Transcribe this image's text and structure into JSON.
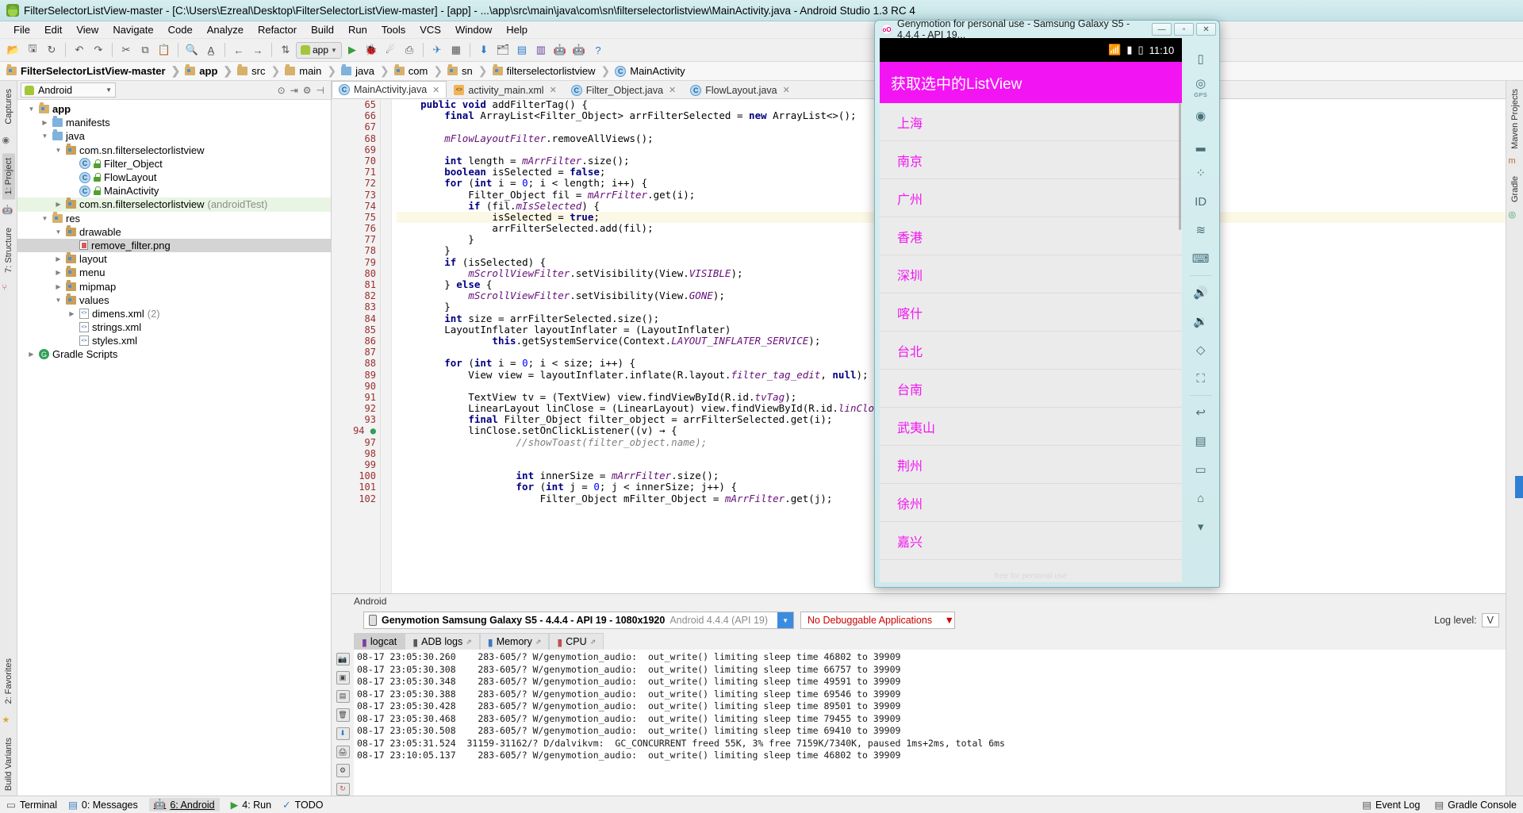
{
  "window": {
    "title": "FilterSelectorListView-master - [C:\\Users\\Ezreal\\Desktop\\FilterSelectorListView-master] - [app] - ...\\app\\src\\main\\java\\com\\sn\\filterselectorlistview\\MainActivity.java - Android Studio 1.3 RC 4"
  },
  "menu": [
    "File",
    "Edit",
    "View",
    "Navigate",
    "Code",
    "Analyze",
    "Refactor",
    "Build",
    "Run",
    "Tools",
    "VCS",
    "Window",
    "Help"
  ],
  "toolbar": {
    "run_config": "app"
  },
  "breadcrumb": [
    {
      "label": "FilterSelectorListView-master",
      "icon": "module-icon",
      "bold": true
    },
    {
      "label": "app",
      "icon": "module-icon",
      "bold": true
    },
    {
      "label": "src",
      "icon": "folder-icon",
      "bold": false
    },
    {
      "label": "main",
      "icon": "folder-icon",
      "bold": false
    },
    {
      "label": "java",
      "icon": "folder-blue-icon",
      "bold": false
    },
    {
      "label": "com",
      "icon": "package-icon",
      "bold": false
    },
    {
      "label": "sn",
      "icon": "package-icon",
      "bold": false
    },
    {
      "label": "filterselectorlistview",
      "icon": "package-icon",
      "bold": false
    },
    {
      "label": "MainActivity",
      "icon": "class-icon",
      "bold": false
    }
  ],
  "left_rail": [
    "Captures",
    "1: Project",
    "7: Structure"
  ],
  "right_rail": [
    "Maven Projects",
    "Gradle"
  ],
  "project": {
    "view_selector": "Android",
    "tree": [
      {
        "label": "app",
        "indent": 0,
        "twisty": "down",
        "icon": "module-icon",
        "bold": true,
        "state": "normal"
      },
      {
        "label": "manifests",
        "indent": 1,
        "twisty": "right",
        "icon": "folder-blue-icon",
        "bold": false,
        "state": "normal"
      },
      {
        "label": "java",
        "indent": 1,
        "twisty": "down",
        "icon": "folder-blue-icon",
        "bold": false,
        "state": "normal"
      },
      {
        "label": "com.sn.filterselectorlistview",
        "indent": 2,
        "twisty": "down",
        "icon": "package-icon",
        "bold": false,
        "state": "normal"
      },
      {
        "label": "Filter_Object",
        "indent": 3,
        "twisty": "none",
        "icon": "class-icon",
        "bold": false,
        "state": "normal"
      },
      {
        "label": "FlowLayout",
        "indent": 3,
        "twisty": "none",
        "icon": "class-icon",
        "bold": false,
        "state": "normal"
      },
      {
        "label": "MainActivity",
        "indent": 3,
        "twisty": "none",
        "icon": "class-icon",
        "bold": false,
        "state": "normal"
      },
      {
        "label": "com.sn.filterselectorlistview",
        "suffix": "(androidTest)",
        "indent": 2,
        "twisty": "right",
        "icon": "package-icon",
        "bold": false,
        "state": "green"
      },
      {
        "label": "res",
        "indent": 1,
        "twisty": "down",
        "icon": "res-icon",
        "bold": false,
        "state": "normal"
      },
      {
        "label": "drawable",
        "indent": 2,
        "twisty": "down",
        "icon": "package-icon",
        "bold": false,
        "state": "normal"
      },
      {
        "label": "remove_filter.png",
        "indent": 3,
        "twisty": "none",
        "icon": "image-icon",
        "bold": false,
        "state": "selected"
      },
      {
        "label": "layout",
        "indent": 2,
        "twisty": "right",
        "icon": "package-icon",
        "bold": false,
        "state": "normal"
      },
      {
        "label": "menu",
        "indent": 2,
        "twisty": "right",
        "icon": "package-icon",
        "bold": false,
        "state": "normal"
      },
      {
        "label": "mipmap",
        "indent": 2,
        "twisty": "right",
        "icon": "package-icon",
        "bold": false,
        "state": "normal"
      },
      {
        "label": "values",
        "indent": 2,
        "twisty": "down",
        "icon": "package-icon",
        "bold": false,
        "state": "normal"
      },
      {
        "label": "dimens.xml",
        "suffix": "(2)",
        "indent": 3,
        "twisty": "right",
        "icon": "xml-icon",
        "bold": false,
        "state": "normal"
      },
      {
        "label": "strings.xml",
        "indent": 3,
        "twisty": "none",
        "icon": "xml-icon",
        "bold": false,
        "state": "normal"
      },
      {
        "label": "styles.xml",
        "indent": 3,
        "twisty": "none",
        "icon": "xml-icon",
        "bold": false,
        "state": "normal"
      },
      {
        "label": "Gradle Scripts",
        "indent": 0,
        "twisty": "right",
        "icon": "gradle-icon",
        "bold": false,
        "state": "normal"
      }
    ]
  },
  "editor": {
    "tabs": [
      {
        "label": "MainActivity.java",
        "icon": "class-icon",
        "active": true
      },
      {
        "label": "activity_main.xml",
        "icon": "xml-icon",
        "active": false
      },
      {
        "label": "Filter_Object.java",
        "icon": "class-icon",
        "active": false
      },
      {
        "label": "FlowLayout.java",
        "icon": "class-icon",
        "active": false
      }
    ],
    "line_numbers": [
      65,
      66,
      67,
      68,
      69,
      70,
      71,
      72,
      73,
      74,
      75,
      76,
      77,
      78,
      79,
      80,
      81,
      82,
      83,
      84,
      85,
      86,
      87,
      88,
      89,
      90,
      91,
      92,
      93,
      94,
      97,
      98,
      99,
      100,
      101,
      102
    ],
    "highlight_line": 75,
    "lines": [
      {
        "num": 65,
        "html": "    <span class=\"k\">public void</span> addFilterTag() {"
      },
      {
        "num": 66,
        "html": "        <span class=\"k\">final</span> ArrayList&lt;Filter_Object&gt; arrFilterSelected = <span class=\"k\">new</span> ArrayList&lt;&gt;();"
      },
      {
        "num": 67,
        "html": ""
      },
      {
        "num": 68,
        "html": "        <span class=\"f\">mFlowLayoutFilter</span>.removeAllViews();"
      },
      {
        "num": 69,
        "html": ""
      },
      {
        "num": 70,
        "html": "        <span class=\"k\">int</span> length = <span class=\"f\">mArrFilter</span>.size();"
      },
      {
        "num": 71,
        "html": "        <span class=\"k\">boolean</span> isSelected = <span class=\"k\">false</span>;"
      },
      {
        "num": 72,
        "html": "        <span class=\"k\">for</span> (<span class=\"k\">int</span> i = <span class=\"n\">0</span>; i &lt; length; i++) {"
      },
      {
        "num": 73,
        "html": "            Filter_Object fil = <span class=\"f\">mArrFilter</span>.get(i);"
      },
      {
        "num": 74,
        "html": "            <span class=\"k\">if</span> (fil.<span class=\"f\">mIsSelected</span>) {"
      },
      {
        "num": 75,
        "html": "                isSelected = <span class=\"k\">true</span>;"
      },
      {
        "num": 76,
        "html": "                arrFilterSelected.add(fil);"
      },
      {
        "num": 77,
        "html": "            }"
      },
      {
        "num": 78,
        "html": "        }"
      },
      {
        "num": 79,
        "html": "        <span class=\"k\">if</span> (isSelected) {"
      },
      {
        "num": 80,
        "html": "            <span class=\"f\">mScrollViewFilter</span>.setVisibility(View.<span class=\"m\">VISIBLE</span>);"
      },
      {
        "num": 81,
        "html": "        } <span class=\"k\">else</span> {"
      },
      {
        "num": 82,
        "html": "            <span class=\"f\">mScrollViewFilter</span>.setVisibility(View.<span class=\"m\">GONE</span>);"
      },
      {
        "num": 83,
        "html": "        }"
      },
      {
        "num": 84,
        "html": "        <span class=\"k\">int</span> size = arrFilterSelected.size();"
      },
      {
        "num": 85,
        "html": "        LayoutInflater layoutInflater = (LayoutInflater)"
      },
      {
        "num": 86,
        "html": "                <span class=\"k\">this</span>.getSystemService(Context.<span class=\"m\">LAYOUT_INFLATER_SERVICE</span>);"
      },
      {
        "num": 87,
        "html": ""
      },
      {
        "num": 88,
        "html": "        <span class=\"k\">for</span> (<span class=\"k\">int</span> i = <span class=\"n\">0</span>; i &lt; size; i++) {"
      },
      {
        "num": 89,
        "html": "            View view = layoutInflater.inflate(R.layout.<span class=\"f\">filter_tag_edit</span>, <span class=\"k\">null</span>);"
      },
      {
        "num": 90,
        "html": ""
      },
      {
        "num": 91,
        "html": "            TextView tv = (TextView) view.findViewById(R.id.<span class=\"f\">tvTag</span>);"
      },
      {
        "num": 92,
        "html": "            LinearLayout linClose = (LinearLayout) view.findViewById(R.id.<span class=\"f\">linClose</span>);"
      },
      {
        "num": 93,
        "html": "            <span class=\"k\">final</span> Filter_Object filter_object = arrFilterSelected.get(i);"
      },
      {
        "num": 94,
        "html": "            linClose.setOnClickListener((v) → {"
      },
      {
        "num": 97,
        "html": "                    <span class=\"c\">//showToast(filter_object.name);</span>"
      },
      {
        "num": 98,
        "html": ""
      },
      {
        "num": 99,
        "html": ""
      },
      {
        "num": 100,
        "html": "                    <span class=\"k\">int</span> innerSize = <span class=\"f\">mArrFilter</span>.size();"
      },
      {
        "num": 101,
        "html": "                    <span class=\"k\">for</span> (<span class=\"k\">int</span> j = <span class=\"n\">0</span>; j &lt; innerSize; j++) {"
      },
      {
        "num": 102,
        "html": "                        Filter_Object mFilter_Object = <span class=\"f\">mArrFilter</span>.get(j);"
      }
    ]
  },
  "android_panel": {
    "header": "Android",
    "device": "Genymotion Samsung Galaxy S5 - 4.4.4 - API 19 - 1080x1920",
    "device_suffix": "Android 4.4.4 (API 19)",
    "debuggable": "No Debuggable Applications",
    "log_level_label": "Log level:",
    "log_level_value": "V",
    "tabs": [
      {
        "label": "logcat",
        "active": true
      },
      {
        "label": "ADB logs",
        "active": false
      },
      {
        "label": "Memory",
        "active": false
      },
      {
        "label": "CPU",
        "active": false
      }
    ],
    "log_lines": [
      "08-17 23:05:30.260    283-605/? W/genymotion_audio:  out_write() limiting sleep time 46802 to 39909",
      "08-17 23:05:30.308    283-605/? W/genymotion_audio:  out_write() limiting sleep time 66757 to 39909",
      "08-17 23:05:30.348    283-605/? W/genymotion_audio:  out_write() limiting sleep time 49591 to 39909",
      "08-17 23:05:30.388    283-605/? W/genymotion_audio:  out_write() limiting sleep time 69546 to 39909",
      "08-17 23:05:30.428    283-605/? W/genymotion_audio:  out_write() limiting sleep time 89501 to 39909",
      "08-17 23:05:30.468    283-605/? W/genymotion_audio:  out_write() limiting sleep time 79455 to 39909",
      "08-17 23:05:30.508    283-605/? W/genymotion_audio:  out_write() limiting sleep time 69410 to 39909",
      "08-17 23:05:31.524  31159-31162/? D/dalvikvm:  GC_CONCURRENT freed 55K, 3% free 7159K/7340K, paused 1ms+2ms, total 6ms",
      "08-17 23:10:05.137    283-605/? W/genymotion_audio:  out_write() limiting sleep time 46802 to 39909"
    ]
  },
  "statusbar": {
    "left": [
      {
        "label": "Terminal",
        "icon": "terminal-icon"
      },
      {
        "label": "0: Messages",
        "icon": "messages-icon"
      },
      {
        "label": "6: Android",
        "icon": "android-icon",
        "active": true
      },
      {
        "label": "4: Run",
        "icon": "run-icon"
      },
      {
        "label": "TODO",
        "icon": "todo-icon"
      }
    ],
    "right": [
      {
        "label": "Event Log",
        "icon": "event-log-icon"
      },
      {
        "label": "Gradle Console",
        "icon": "gradle-console-icon"
      }
    ]
  },
  "genymotion": {
    "title": "Genymotion for personal use - Samsung Galaxy S5 - 4.4.4 - API 19...",
    "window_buttons": [
      "minimize",
      "maximize",
      "close"
    ],
    "status_time": "11:10",
    "app_title": "获取选中的ListView",
    "list_items": [
      "上海",
      "南京",
      "广州",
      "香港",
      "深圳",
      "喀什",
      "台北",
      "台南",
      "武夷山",
      "荆州",
      "徐州",
      "嘉兴"
    ],
    "watermark": "free for personal use",
    "side_buttons": [
      {
        "label": "GPS",
        "icon": "phone-icon"
      },
      {
        "label": "",
        "icon": "gps-icon"
      },
      {
        "label": "",
        "icon": "target-icon"
      },
      {
        "label": "",
        "icon": "battery-icon"
      },
      {
        "label": "",
        "icon": "pixel-icon"
      },
      {
        "label": "ID",
        "icon": "id-icon"
      },
      {
        "label": "",
        "icon": "network-icon"
      },
      {
        "label": "",
        "icon": "keyboard-icon"
      },
      {
        "label": "",
        "icon": "volume-up-icon"
      },
      {
        "label": "",
        "icon": "volume-down-icon"
      },
      {
        "label": "",
        "icon": "rotate-icon"
      },
      {
        "label": "",
        "icon": "fullscreen-icon"
      },
      {
        "label": "",
        "icon": "back-icon"
      },
      {
        "label": "",
        "icon": "recents-icon"
      },
      {
        "label": "",
        "icon": "menu-icon"
      },
      {
        "label": "",
        "icon": "home-icon"
      }
    ]
  },
  "colors": {
    "accent_magenta": "#f314f3",
    "geny_titlebar": "#d6eef0",
    "selection_gray": "#d4d4d4",
    "highlight_yellow": "#fcf8e6"
  }
}
